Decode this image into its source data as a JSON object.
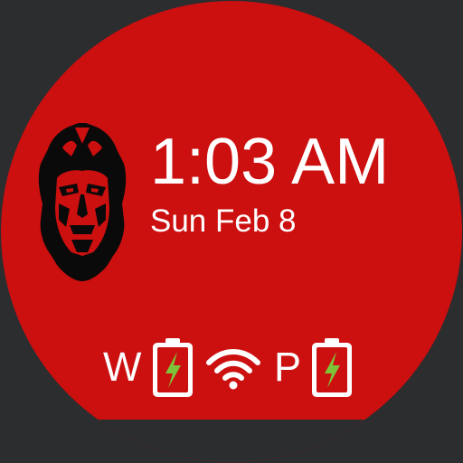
{
  "watchface": {
    "time": "1:03 AM",
    "date": "Sun Feb 8",
    "accent_color": "#cc0f0f",
    "background_color": "#2b2d2f",
    "mascot_icon": "helmeted-face-icon"
  },
  "status": {
    "watch_label": "W",
    "watch_battery_icon": "battery-charging-icon",
    "wifi_icon": "wifi-icon",
    "phone_label": "P",
    "phone_battery_icon": "battery-charging-icon",
    "bolt_color": "#7ec43a"
  }
}
